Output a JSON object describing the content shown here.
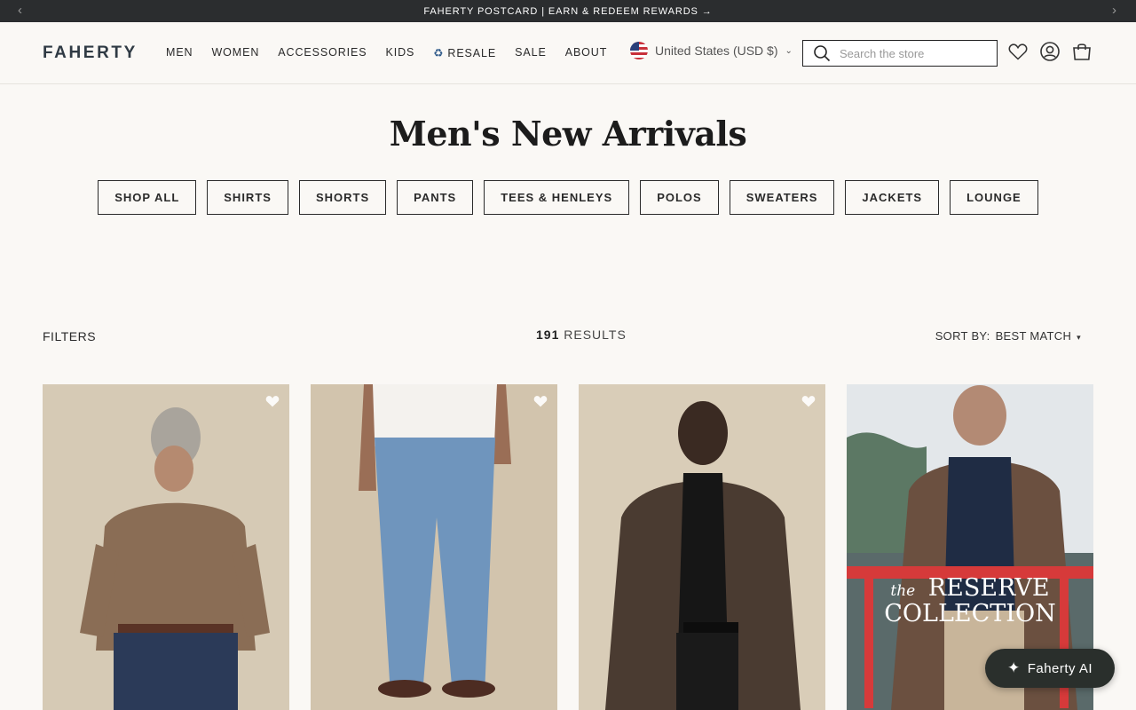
{
  "announcement": {
    "text": "FAHERTY POSTCARD | EARN & REDEEM REWARDS →",
    "prev_arrow": "‹",
    "next_arrow": "›"
  },
  "header": {
    "logo": "FAHERTY",
    "nav": [
      {
        "label": "MEN"
      },
      {
        "label": "WOMEN"
      },
      {
        "label": "ACCESSORIES"
      },
      {
        "label": "KIDS"
      },
      {
        "label": "RESALE",
        "icon": "recycle-icon"
      },
      {
        "label": "SALE"
      },
      {
        "label": "ABOUT"
      }
    ],
    "region": {
      "label": "United States (USD $)",
      "icon": "us-flag-icon"
    },
    "search": {
      "placeholder": "Search the store",
      "value": ""
    },
    "icons": [
      "wishlist-heart-icon",
      "account-icon",
      "cart-bag-icon"
    ]
  },
  "page": {
    "title": "Men's New Arrivals",
    "categories": [
      "SHOP ALL",
      "SHIRTS",
      "SHORTS",
      "PANTS",
      "TEES & HENLEYS",
      "POLOS",
      "SWEATERS",
      "JACKETS",
      "LOUNGE"
    ]
  },
  "toolbar": {
    "filters_label": "FILTERS",
    "results_count": "191",
    "results_label": "RESULTS",
    "sort_label": "SORT BY:",
    "sort_value": "BEST MATCH"
  },
  "products": [
    {
      "image": "man in tan polo sweater and dark jeans",
      "wishlist": true
    },
    {
      "image": "man in white tee and light blue jeans",
      "wishlist": true
    },
    {
      "image": "man in brown jacket over black shirt",
      "wishlist": true
    },
    {
      "image": "promo",
      "promo_small": "the",
      "promo_line1": "RESERVE",
      "promo_line2": "COLLECTION",
      "wishlist": false
    }
  ],
  "assistant": {
    "label": "Faherty AI",
    "icon": "sparkle-icon"
  },
  "colors": {
    "announce_bg": "#2b2d2f",
    "page_bg": "#faf8f5",
    "logo": "#2f3a44",
    "ai_pill": "#2a2f2c"
  }
}
